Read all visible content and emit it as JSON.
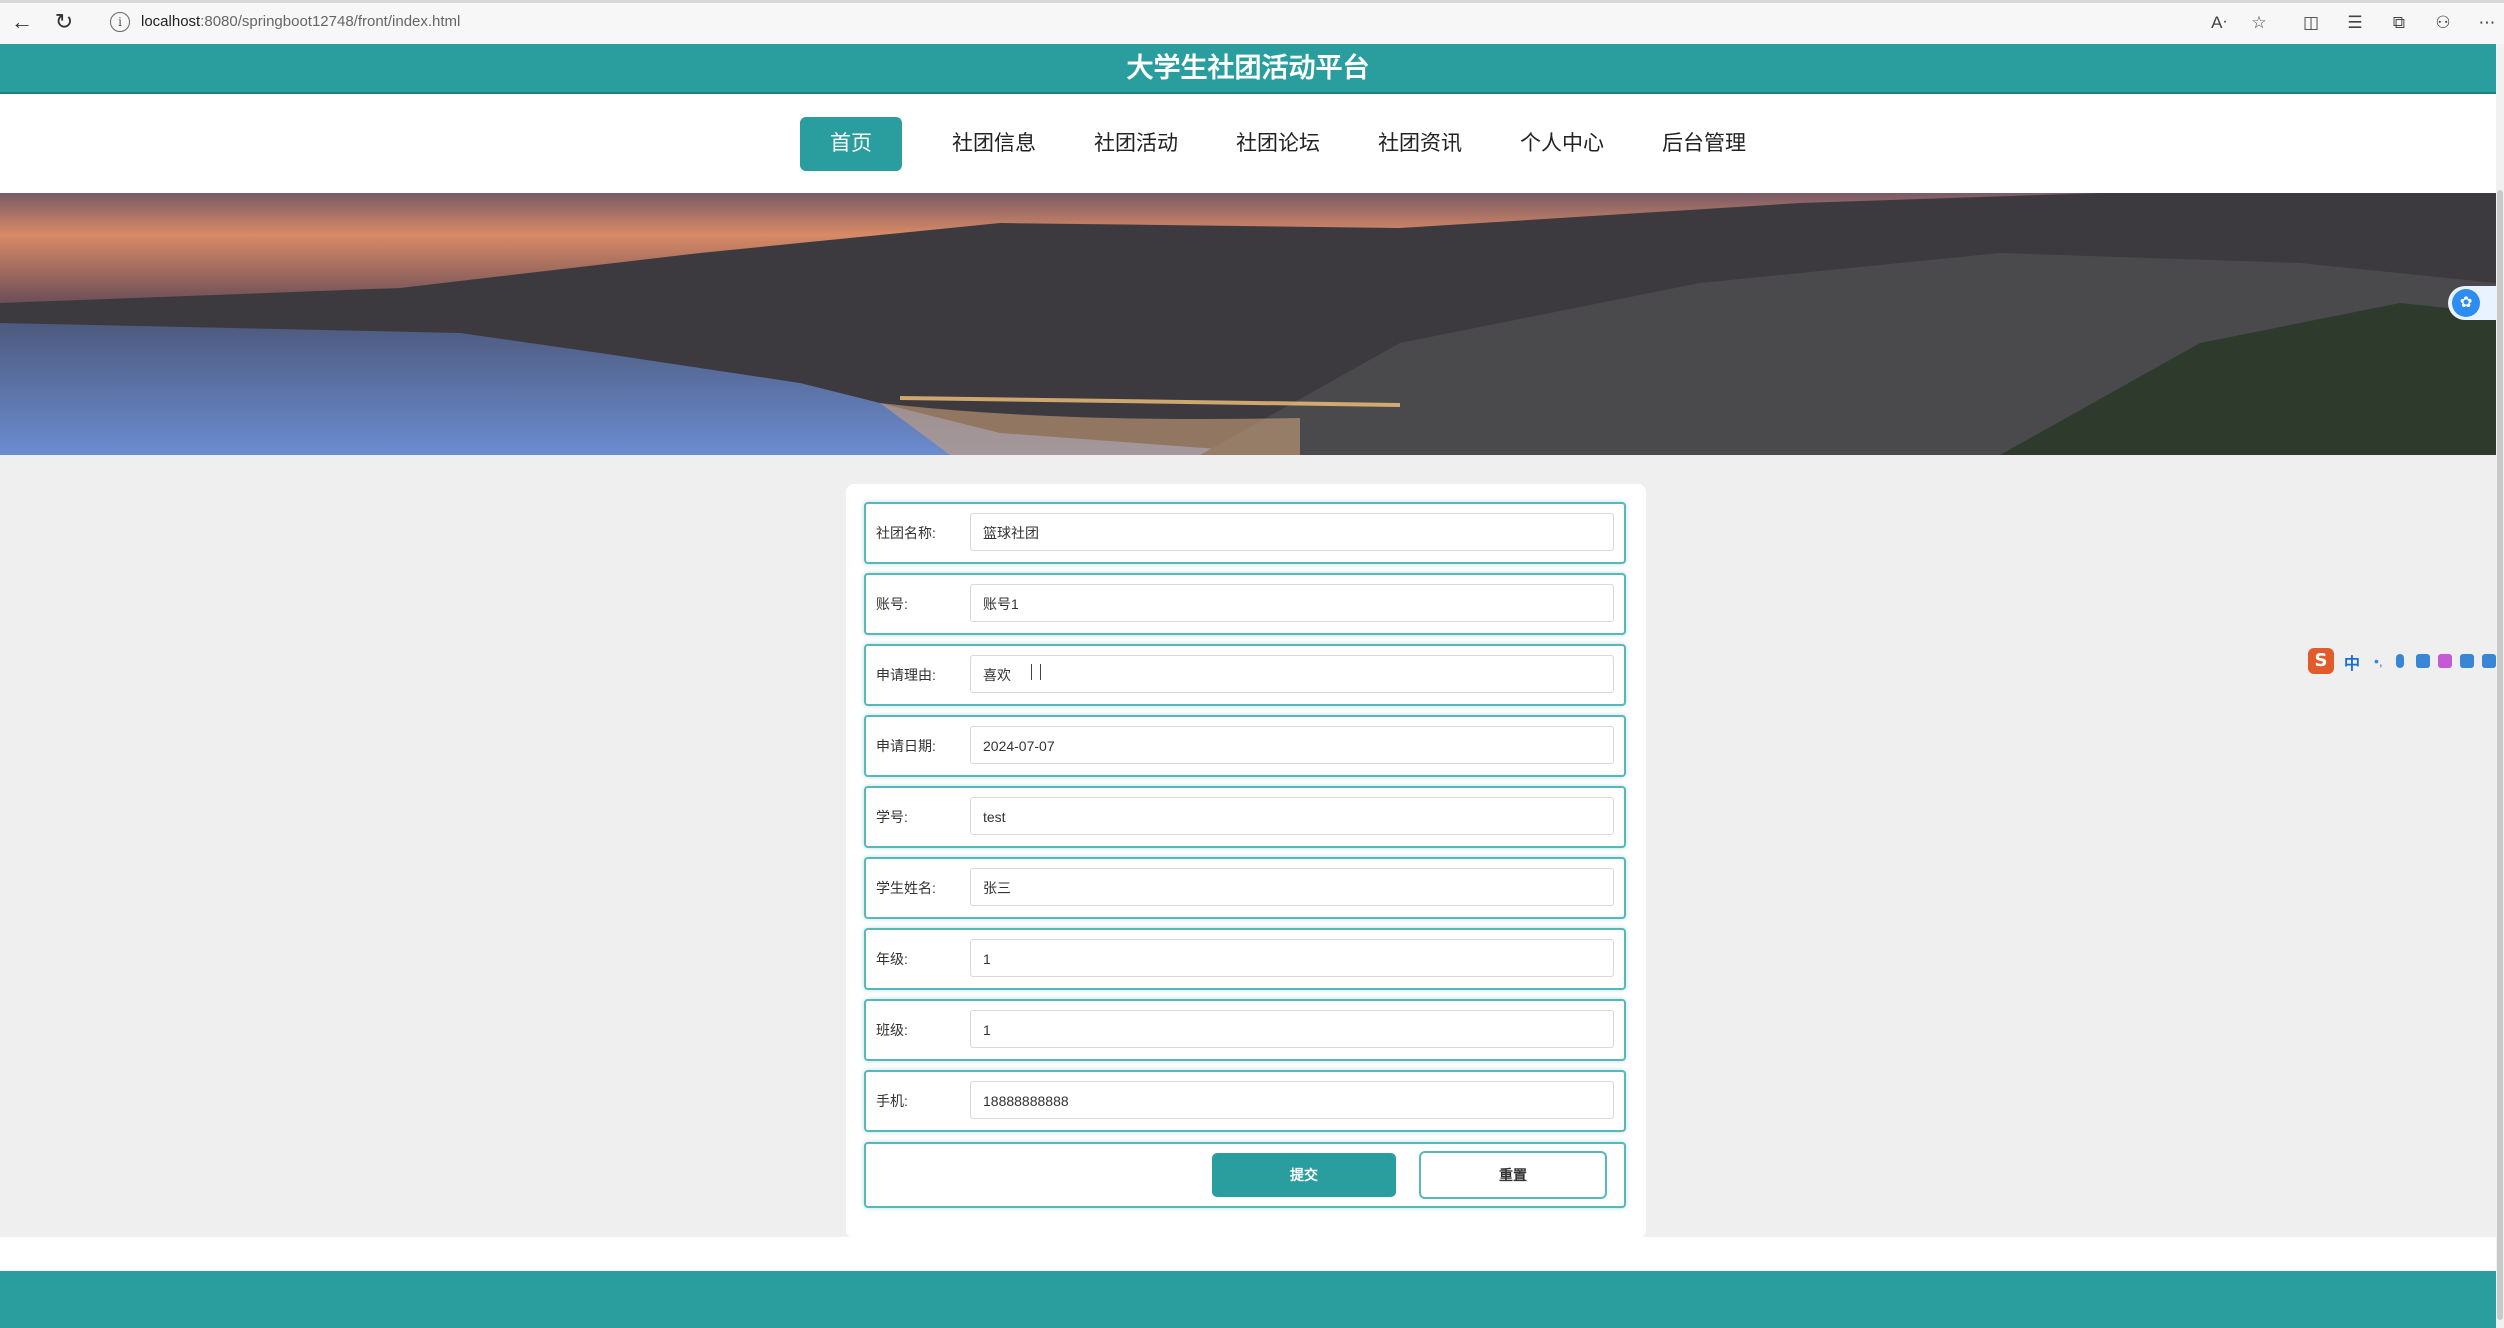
{
  "browser": {
    "url_host": "localhost",
    "url_rest": ":8080/springboot12748/front/index.html"
  },
  "header": {
    "title": "大学生社团活动平台"
  },
  "nav": {
    "items": [
      {
        "label": "首页"
      },
      {
        "label": "社团信息"
      },
      {
        "label": "社团活动"
      },
      {
        "label": "社团论坛"
      },
      {
        "label": "社团资讯"
      },
      {
        "label": "个人中心"
      },
      {
        "label": "后台管理"
      }
    ],
    "active_index": 0
  },
  "form": {
    "fields": [
      {
        "label": "社团名称:",
        "value": "篮球社团"
      },
      {
        "label": "账号:",
        "value": "账号1"
      },
      {
        "label": "申请理由:",
        "value": "喜欢"
      },
      {
        "label": "申请日期:",
        "value": "2024-07-07"
      },
      {
        "label": "学号:",
        "value": "test"
      },
      {
        "label": "学生姓名:",
        "value": "张三"
      },
      {
        "label": "年级:",
        "value": "1"
      },
      {
        "label": "班级:",
        "value": "1"
      },
      {
        "label": "手机:",
        "value": "18888888888"
      }
    ],
    "submit_label": "提交",
    "reset_label": "重置"
  },
  "ime": {
    "lang": "中"
  },
  "colors": {
    "primary": "#2a9d9f",
    "border": "#56b8b9"
  }
}
